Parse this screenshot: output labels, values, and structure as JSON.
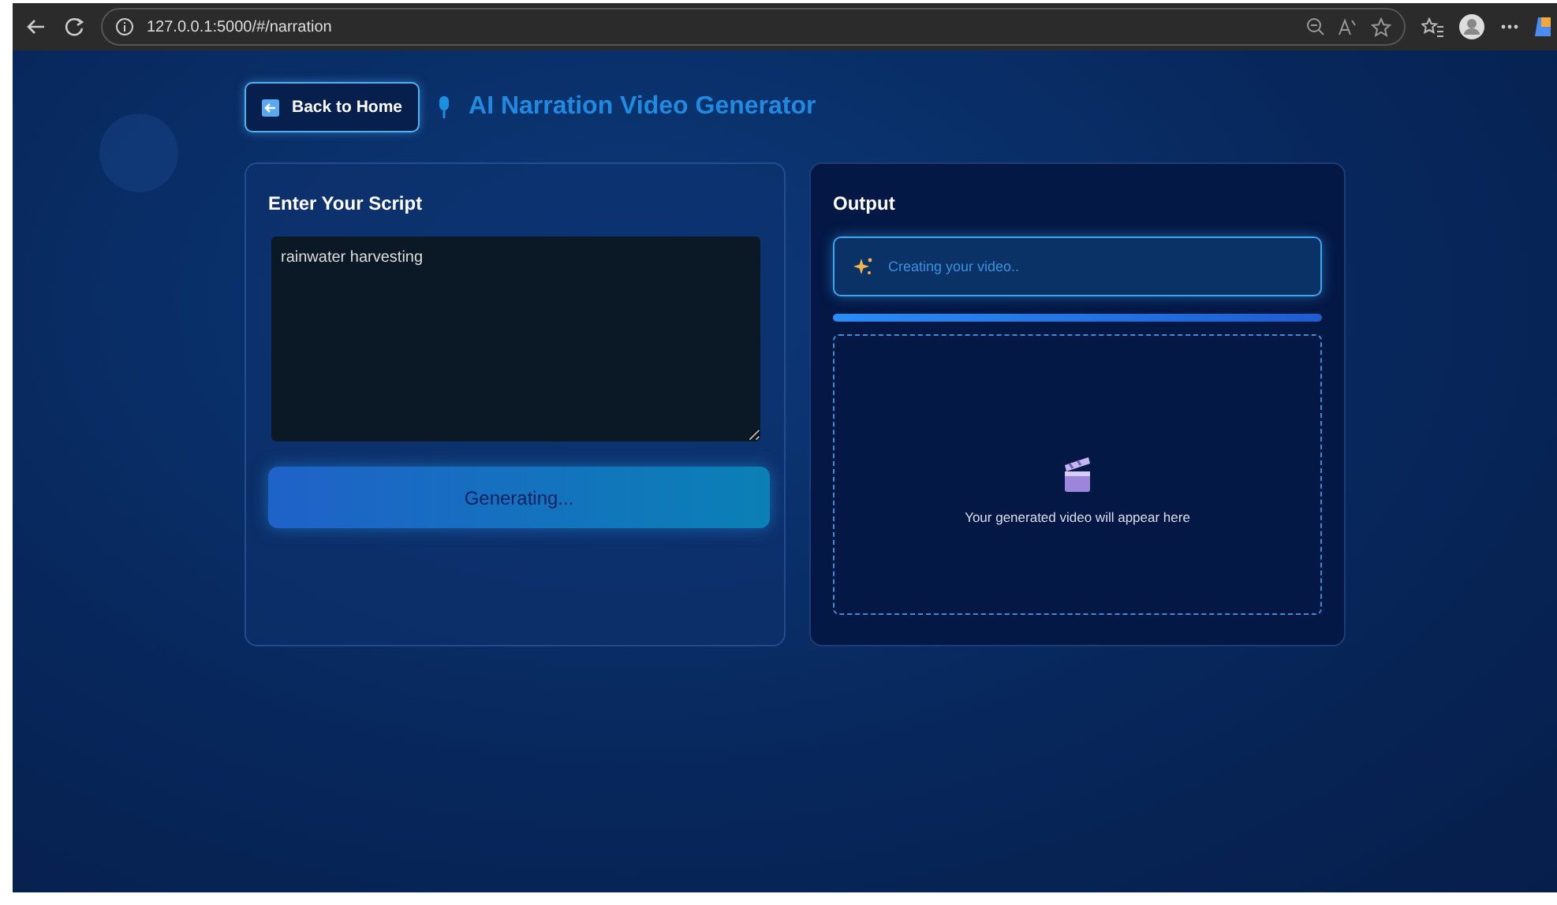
{
  "browser": {
    "url": "127.0.0.1:5000/#/narration"
  },
  "header": {
    "back_button": "Back to Home",
    "title": "AI Narration Video Generator"
  },
  "script_panel": {
    "title": "Enter Your Script",
    "value": "rainwater harvesting",
    "button": {
      "label": "Generating...",
      "disabled": true
    }
  },
  "output_panel": {
    "title": "Output",
    "status": "Creating your video..",
    "progress": {
      "level": 1
    },
    "placeholder": "Your generated video will appear here"
  }
}
